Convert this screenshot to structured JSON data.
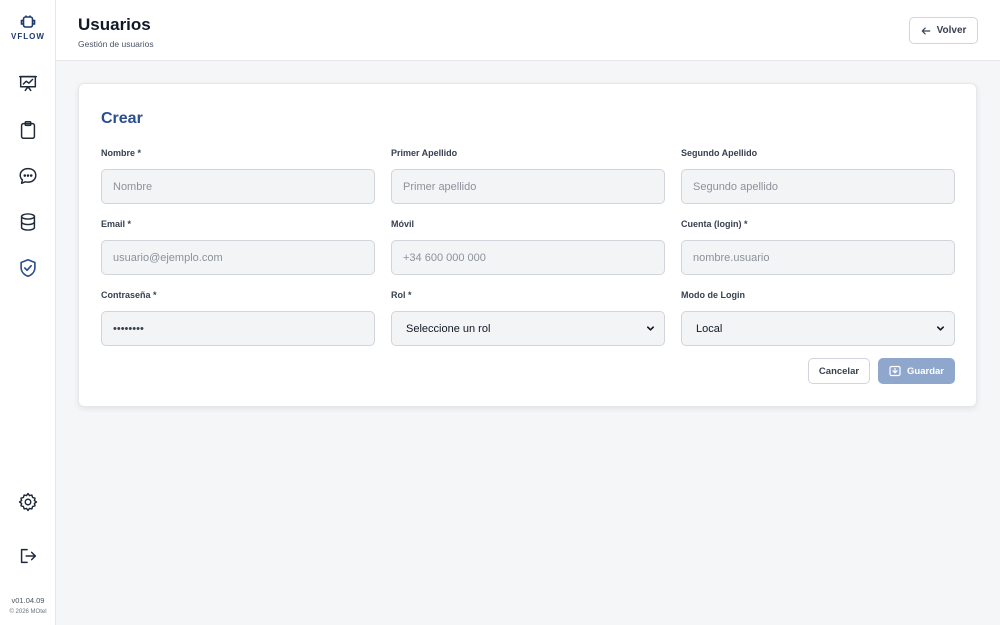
{
  "sidebar": {
    "logo_text": "VFLOW",
    "items": [
      {
        "name": "dashboard",
        "icon": "presentation-chart-icon"
      },
      {
        "name": "tasks",
        "icon": "clipboard-icon"
      },
      {
        "name": "messages",
        "icon": "chat-bubble-icon"
      },
      {
        "name": "database",
        "icon": "database-icon"
      },
      {
        "name": "security",
        "icon": "shield-check-icon"
      }
    ],
    "settings_icon": "gear-icon",
    "logout_icon": "logout-icon",
    "version": "v01.04.09",
    "copyright": "© 2026 MOtel"
  },
  "header": {
    "title": "Usuarios",
    "subtitle": "Gestión de usuarios",
    "back_label": "Volver"
  },
  "form": {
    "title": "Crear",
    "fields": [
      {
        "label": "Nombre *",
        "placeholder": "Nombre",
        "value": ""
      },
      {
        "label": "Primer Apellido",
        "placeholder": "Primer apellido",
        "value": ""
      },
      {
        "label": "Segundo Apellido",
        "placeholder": "Segundo apellido",
        "value": ""
      },
      {
        "label": "Email *",
        "placeholder": "usuario@ejemplo.com",
        "value": ""
      },
      {
        "label": "Móvil",
        "placeholder": "+34 600 000 000",
        "value": ""
      },
      {
        "label": "Cuenta (login) *",
        "placeholder": "nombre.usuario",
        "value": ""
      },
      {
        "label": "Contraseña *",
        "placeholder": "",
        "value": "••••••••"
      },
      {
        "label": "Rol *",
        "selected": "Seleccione un rol"
      },
      {
        "label": "Modo de Login",
        "selected": "Local"
      }
    ],
    "cancel_label": "Cancelar",
    "save_label": "Guardar"
  },
  "colors": {
    "accent": "#2b4f8e",
    "save_disabled": "#8fa7cd",
    "logo": "#1e3a6e"
  }
}
